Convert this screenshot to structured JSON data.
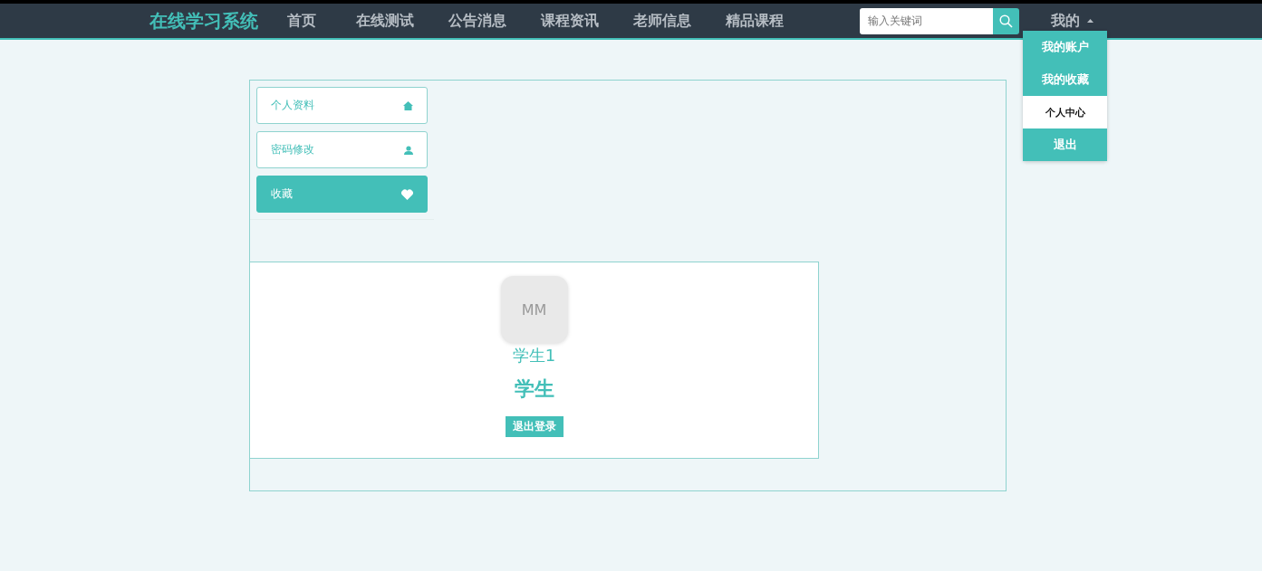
{
  "brand": "在线学习系统",
  "nav": [
    {
      "label": "首页"
    },
    {
      "label": "在线测试"
    },
    {
      "label": "公告消息"
    },
    {
      "label": "课程资讯"
    },
    {
      "label": "老师信息"
    },
    {
      "label": "精品课程"
    }
  ],
  "search": {
    "placeholder": "输入关键词"
  },
  "user_menu": {
    "label": "我的",
    "expanded": true,
    "items": [
      {
        "label": "我的账户",
        "selected": false
      },
      {
        "label": "我的收藏",
        "selected": false
      },
      {
        "label": "个人中心",
        "selected": true
      },
      {
        "label": "退出",
        "selected": false
      }
    ]
  },
  "sidebar": {
    "items": [
      {
        "label": "个人资料",
        "selected": false
      },
      {
        "label": "密码修改",
        "selected": false
      },
      {
        "label": "收藏",
        "selected": true
      }
    ]
  },
  "profile": {
    "avatar": "MM",
    "username": "学生1",
    "role": "学生",
    "logout": "退出登录"
  }
}
